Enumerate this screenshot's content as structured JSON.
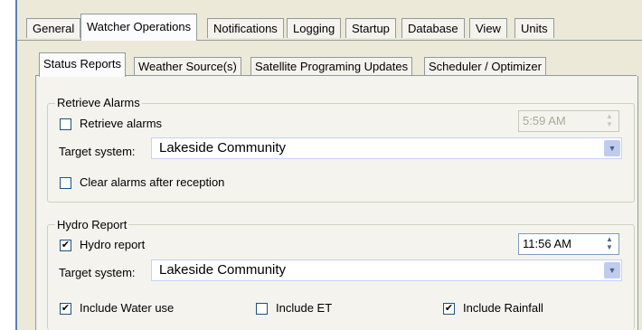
{
  "tabs": [
    {
      "label": "General"
    },
    {
      "label": "Watcher Operations"
    },
    {
      "label": "Notifications"
    },
    {
      "label": "Logging"
    },
    {
      "label": "Startup"
    },
    {
      "label": "Database"
    },
    {
      "label": "View"
    },
    {
      "label": "Units"
    }
  ],
  "active_tab": "Watcher Operations",
  "subtabs": [
    {
      "label": "Status Reports"
    },
    {
      "label": "Weather Source(s)"
    },
    {
      "label": "Satellite Programing Updates"
    },
    {
      "label": "Scheduler / Optimizer"
    }
  ],
  "active_subtab": "Status Reports",
  "retrieve_alarms": {
    "group_title": "Retrieve Alarms",
    "checkbox_label": "Retrieve alarms",
    "checked": false,
    "time_value": "5:59 AM",
    "target_label": "Target system:",
    "target_value": "Lakeside Community",
    "clear_label": "Clear alarms after reception",
    "clear_checked": false
  },
  "hydro_report": {
    "group_title": "Hydro Report",
    "checkbox_label": "Hydro report",
    "checked": true,
    "time_value": "11:56 AM",
    "target_label": "Target system:",
    "target_value": "Lakeside Community",
    "include_water_label": "Include Water use",
    "include_water_checked": true,
    "include_et_label": "Include ET",
    "include_et_checked": false,
    "include_rainfall_label": "Include Rainfall",
    "include_rainfall_checked": true
  },
  "icons": {
    "check": "✔",
    "combo_arrow": "▼",
    "spin_up": "▲",
    "spin_down": "▼"
  }
}
